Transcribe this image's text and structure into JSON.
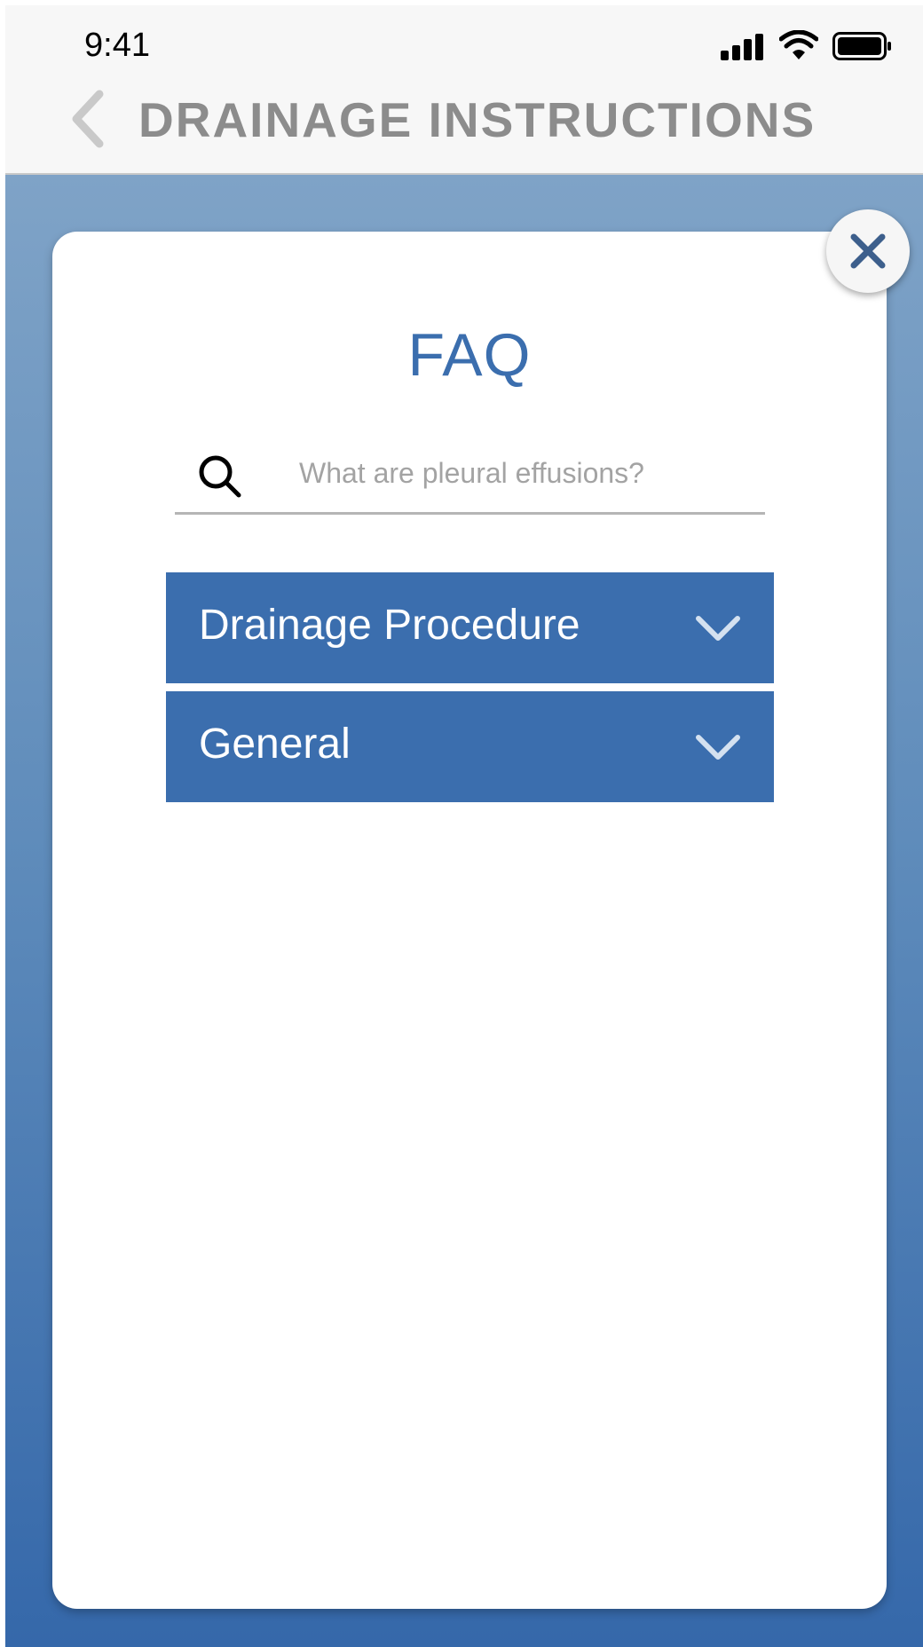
{
  "status_bar": {
    "time": "9:41",
    "icons": [
      "signal-icon",
      "wifi-icon",
      "battery-icon"
    ]
  },
  "nav": {
    "back_icon": "chevron-left-icon",
    "title": "DRAINAGE INSTRUCTIONS"
  },
  "modal": {
    "close_icon": "close-icon",
    "title": "FAQ",
    "search": {
      "icon": "search-icon",
      "placeholder": "What are pleural effusions?",
      "value": ""
    },
    "sections": [
      {
        "label": "Drainage Procedure",
        "icon": "chevron-down-icon",
        "expanded": false
      },
      {
        "label": "General",
        "icon": "chevron-down-icon",
        "expanded": false
      }
    ]
  },
  "colors": {
    "accent": "#3b6eae",
    "nav_title": "#8c8c8c",
    "gradient_top": "#7fa3c7",
    "gradient_bottom": "#3568aa",
    "close_icon": "#3d5f8c"
  }
}
